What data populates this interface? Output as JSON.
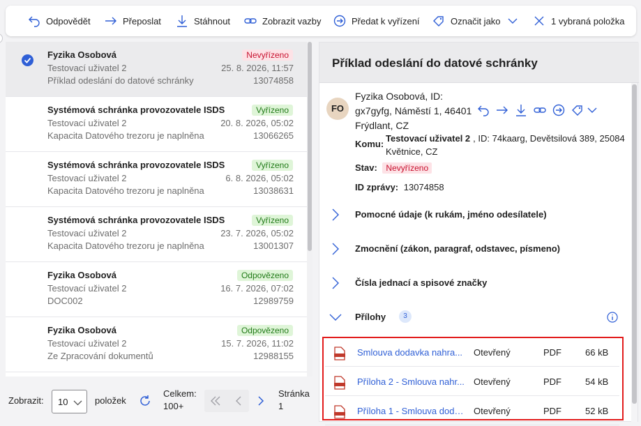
{
  "toolbar": {
    "reply": "Odpovědět",
    "forward": "Přeposlat",
    "download": "Stáhnout",
    "show_links": "Zobrazit vazby",
    "handover": "Předat k vyřízení",
    "mark_as": "Označit jako",
    "selected": "1 vybraná položka"
  },
  "messages": [
    {
      "sender": "Fyzika Osobová",
      "status": "Nevyřízeno",
      "status_color": "red",
      "to": "Testovací uživatel 2",
      "date": "25. 8. 2026, 11:57",
      "subject": "Příklad odeslání do datové schránky",
      "id": "13074858",
      "selected": true
    },
    {
      "sender": "Systémová schránka provozovatele ISDS",
      "status": "Vyřízeno",
      "status_color": "green",
      "to": "Testovací uživatel 2",
      "date": "20. 8. 2026, 05:02",
      "subject": "Kapacita Datového trezoru je naplněna",
      "id": "13066265",
      "selected": false
    },
    {
      "sender": "Systémová schránka provozovatele ISDS",
      "status": "Vyřízeno",
      "status_color": "green",
      "to": "Testovací uživatel 2",
      "date": "6. 8. 2026, 05:02",
      "subject": "Kapacita Datového trezoru je naplněna",
      "id": "13038631",
      "selected": false
    },
    {
      "sender": "Systémová schránka provozovatele ISDS",
      "status": "Vyřízeno",
      "status_color": "green",
      "to": "Testovací uživatel 2",
      "date": "23. 7. 2026, 05:02",
      "subject": "Kapacita Datového trezoru je naplněna",
      "id": "13001307",
      "selected": false
    },
    {
      "sender": "Fyzika Osobová",
      "status": "Odpovězeno",
      "status_color": "green",
      "to": "Testovací uživatel 2",
      "date": "16. 7. 2026, 07:02",
      "subject": "DOC002",
      "id": "12989759",
      "selected": false
    },
    {
      "sender": "Fyzika Osobová",
      "status": "Odpovězeno",
      "status_color": "green",
      "to": "Testovací uživatel 2",
      "date": "15. 7. 2026, 11:02",
      "subject": "Ze Zpracování dokumentů",
      "id": "12988155",
      "selected": false
    }
  ],
  "pager": {
    "show_label": "Zobrazit:",
    "page_size": "10",
    "items_label": "položek",
    "total_label": "Celkem:",
    "total_value": "100+",
    "page_label": "Stránka",
    "page_value": "1"
  },
  "detail": {
    "title": "Příklad odeslání do datové schránky",
    "avatar": "FO",
    "sender_line1": "Fyzika Osobová, ID:",
    "sender_line2": "gx7gyfg, Náměstí 1, 46401",
    "sender_line3": "Frýdlant, CZ",
    "to_label": "Komu:",
    "to_name": "Testovací uživatel 2",
    "to_rest1": ", ID: 74kaarg, Devětsilová 389, 25084",
    "to_rest2": "Květnice, CZ",
    "status_label": "Stav:",
    "status_value": "Nevyřízeno",
    "id_label": "ID zprávy:",
    "id_value": "13074858",
    "sections": [
      "Pomocné údaje (k rukám, jméno odesílatele)",
      "Zmocnění (zákon, paragraf, odstavec, písmeno)",
      "Čísla jednací a spisové značky"
    ],
    "attachments_label": "Přílohy",
    "attachments_count": "3",
    "attachments": [
      {
        "name": "Smlouva dodavka nahra...",
        "state": "Otevřený",
        "format": "PDF",
        "size": "66 kB"
      },
      {
        "name": "Příloha 2 - Smlouva nahr...",
        "state": "Otevřený",
        "format": "PDF",
        "size": "54 kB"
      },
      {
        "name": "Příloha 1 - Smlouva doda...",
        "state": "Otevřený",
        "format": "PDF",
        "size": "52 kB"
      }
    ]
  },
  "colors": {
    "accent": "#2f5fd6",
    "highlight_border": "#e21c1c",
    "badge_red_bg": "#fde2e6",
    "badge_green_bg": "#dff5d8"
  }
}
